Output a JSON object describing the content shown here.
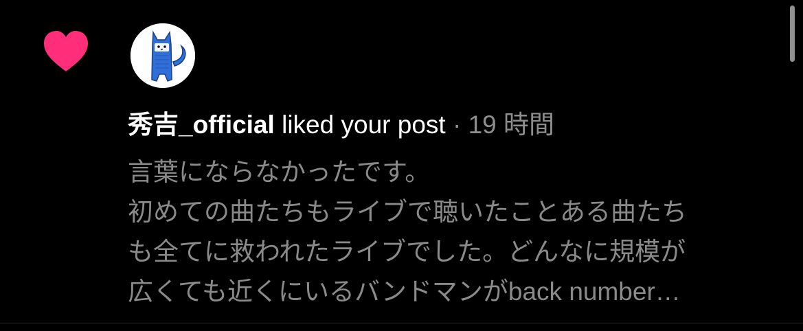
{
  "colors": {
    "background": "#000000",
    "heart": "#ff2d7a",
    "primary_text": "#ffffff",
    "secondary_text": "#8e8e8e",
    "avatar_character": "#2f6fd8"
  },
  "notification": {
    "icon": "heart-icon",
    "avatar_icon": "blue-cat-avatar-icon",
    "username": "秀吉_official",
    "action": "liked your post",
    "separator": "·",
    "time": "19 時間",
    "comment_lines": [
      "言葉にならなかったです。",
      "初めての曲たちもライブで聴いたことある曲たち",
      "も全てに救われたライブでした。どんなに規模が",
      "広くても近くにいるバンドマンがback number…"
    ]
  }
}
